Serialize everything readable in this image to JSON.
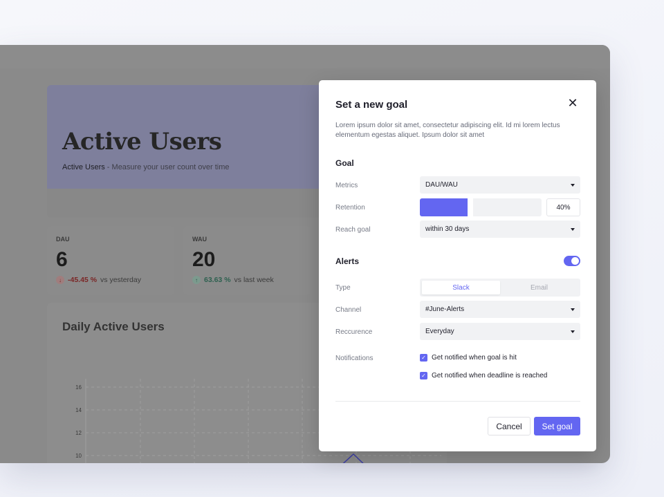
{
  "background": {
    "hero_title": "Active Users",
    "hero_sub_strong": "Active Users",
    "hero_sub_rest": " - Measure your user count over time",
    "stats": [
      {
        "label": "DAU",
        "value": "6",
        "change": "-45.45 %",
        "suffix": "vs yesterday",
        "direction": "down"
      },
      {
        "label": "WAU",
        "value": "20",
        "change": "63.63 %",
        "suffix": "vs last week",
        "direction": "up"
      }
    ],
    "chart_title": "Daily Active Users",
    "chart_yticks": [
      "16",
      "14",
      "12",
      "10"
    ]
  },
  "modal": {
    "title": "Set a new goal",
    "close_icon": "close-icon",
    "description": "Lorem ipsum dolor sit amet, consectetur adipiscing elit. Id mi lorem lectus elementum egestas aliquet.  Ipsum dolor sit amet",
    "goal_section": "Goal",
    "metrics_label": "Metrics",
    "metrics_value": "DAU/WAU",
    "retention_label": "Retention",
    "retention_value": "40%",
    "retention_fraction": 0.4,
    "reach_label": "Reach goal",
    "reach_value": "within 30 days",
    "alerts_section": "Alerts",
    "alerts_enabled": true,
    "type_label": "Type",
    "type_options": [
      "Slack",
      "Email"
    ],
    "type_selected": "Slack",
    "channel_label": "Channel",
    "channel_value": "#June-Alerts",
    "recurrence_label": "Reccurence",
    "recurrence_value": "Everyday",
    "notifications_label": "Notifications",
    "notify_goal": "Get notified when goal is hit",
    "notify_deadline": "Get notified when deadline is reached",
    "cancel_label": "Cancel",
    "submit_label": "Set goal",
    "accent_color": "#6366f1"
  }
}
